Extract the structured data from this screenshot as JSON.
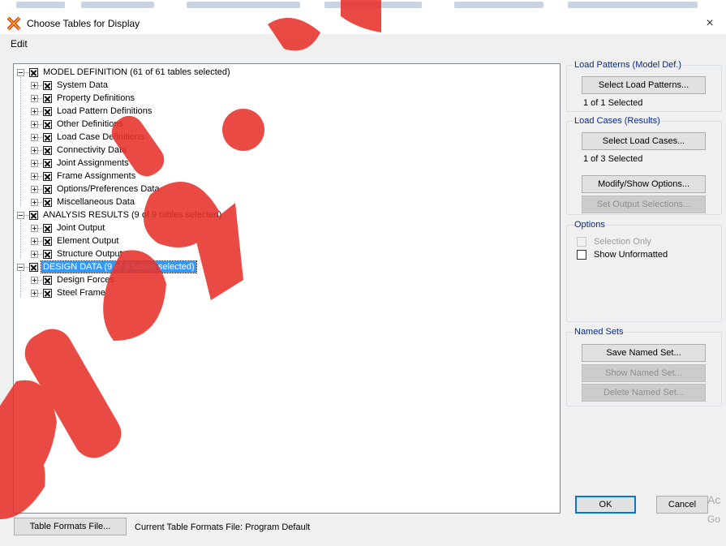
{
  "window": {
    "title": "Choose Tables for Display",
    "close_glyph": "×",
    "icon": "x-cross-app-icon"
  },
  "menu": {
    "edit": "Edit"
  },
  "tree": {
    "groups": [
      {
        "label": "MODEL DEFINITION  (61 of 61 tables selected)",
        "expanded": true,
        "children": [
          "System Data",
          "Property Definitions",
          "Load Pattern Definitions",
          "Other Definitions",
          "Load Case Definitions",
          "Connectivity Data",
          "Joint Assignments",
          "Frame Assignments",
          "Options/Preferences Data",
          "Miscellaneous Data"
        ]
      },
      {
        "label": "ANALYSIS RESULTS  (9 of 9 tables selected)",
        "expanded": true,
        "children": [
          "Joint Output",
          "Element Output",
          "Structure Output"
        ]
      },
      {
        "label": "DESIGN DATA  (9 of 9 tables selected)",
        "expanded": true,
        "selected": true,
        "children": [
          "Design Forces",
          "Steel Frame"
        ]
      }
    ]
  },
  "load_patterns": {
    "title": "Load Patterns (Model Def.)",
    "button": "Select Load Patterns...",
    "status": "1 of 1 Selected"
  },
  "load_cases": {
    "title": "Load Cases (Results)",
    "button": "Select Load Cases...",
    "status": "1 of 3 Selected",
    "modify_button": "Modify/Show Options...",
    "output_button": "Set Output Selections..."
  },
  "options": {
    "title": "Options",
    "selection_only": "Selection Only",
    "show_unformatted": "Show Unformatted"
  },
  "named_sets": {
    "title": "Named Sets",
    "save": "Save Named Set...",
    "show": "Show Named Set...",
    "delete": "Delete Named Set..."
  },
  "footer": {
    "ok": "OK",
    "cancel": "Cancel",
    "table_formats_button": "Table Formats File...",
    "current_file_label": "Current Table Formats File:  Program Default"
  },
  "overlay": {
    "activate_line1": "Ac",
    "activate_line2": "Go",
    "watermark_color": "#e8322b"
  },
  "colors": {
    "selection": "#3399ff",
    "group_title": "#0a2a8a",
    "dialog_bg": "#f0f0f0"
  }
}
